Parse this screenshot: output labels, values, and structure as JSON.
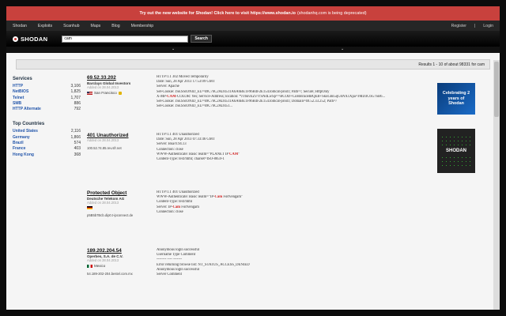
{
  "banner": {
    "message": "Try out the new website for Shodan! Click here to visit https://www.shodan.io",
    "sub": "(shodanhq.com is being deprecated)"
  },
  "nav": {
    "items": [
      "Shodan",
      "Exploits",
      "Scanhub",
      "Maps",
      "Blog",
      "Membership"
    ],
    "register": "Register",
    "separator": "|",
    "login": "Login"
  },
  "header": {
    "logo": "SHODAN",
    "search_value": "cam",
    "search_button": "Search"
  },
  "results": {
    "summary": "Results 1 - 10 of about 98331 for cam"
  },
  "sidebar": {
    "services_title": "Services",
    "services": [
      {
        "name": "HTTP",
        "count": "3,106"
      },
      {
        "name": "NetBIOS",
        "count": "1,825"
      },
      {
        "name": "Telnet",
        "count": "1,707"
      },
      {
        "name": "SMB",
        "count": "886"
      },
      {
        "name": "HTTP Alternate",
        "count": "792"
      }
    ],
    "countries_title": "Top Countries",
    "countries": [
      {
        "name": "United States",
        "count": "2,116"
      },
      {
        "name": "Germany",
        "count": "1,866"
      },
      {
        "name": "Brazil",
        "count": "574"
      },
      {
        "name": "France",
        "count": "403"
      },
      {
        "name": "Hong Kong",
        "count": "368"
      }
    ]
  },
  "hosts": [
    {
      "ip": "69.52.33.202",
      "org": "Barclays Global Investors",
      "meta": "Added on 28.04.2013",
      "location": "San Francisco",
      "flag": "us",
      "hostname": "",
      "banner": [
        "HTTP/1.1 302 Moved Temporarily",
        "Date: Sun, 28 Apr 2013 17:53:09 GMT",
        "Server: Apache",
        "Set-Cookie: JSESSIONID_EU=69C76C2AD4511A6A6BE1F96B4F2E154.tomcat-prod1; Path=/; Secure; HttpOnly",
        "X-MP-CAM-COLOR: Yes; Service-Address; location: *JTbuvEZv/YSNdLwSp==BCOD+CoHBcuoHBQEB+SkuGbn5qG6NX1Xpa=JMD3C6G7SB6...",
        "Set-Cookie: JSESSIONID_EU=69C76C2AD4511A6A6BE1F96B4F2E154.tomcat-prod1; Domain=69.52.33.252; Path=/",
        "Set-Cookie: JSESSIONID_EU=69C76C2AD451..."
      ]
    },
    {
      "ip": "401 Unauthorized",
      "org": "",
      "meta": "Added on 28.04.2013",
      "location": "",
      "flag": "generic",
      "hostname": "100.52.74.85.rev.sfr.net",
      "banner": [
        "HTTP/1.1 401 Unauthorized",
        "Date: Sun, 28 Apr 2013 07:33:46 GMT",
        "Server: Boa/0.94.13",
        "Connection: close",
        "WWW-Authenticate: Basic realm=\"PLANET IP CAM\"",
        "Content-Type: text/html; charset=ISO-8859-1"
      ]
    },
    {
      "ip": "Protected Object",
      "org": "Deutsche Telekom AG",
      "meta": "Added on 28.04.2013",
      "location": "",
      "flag": "de",
      "hostname": "p5B5b7Bcb.dip0.t-ipconnect.de",
      "banner": [
        "HTTP/1.1 401 Unauthorized",
        "WWW-Authenticate: Basic realm=\"IP-Cam Fortvengam\"",
        "Content-Type: text/html",
        "Server: IP-Cam Fortvengam",
        "Connection: close"
      ]
    },
    {
      "ip": "189.202.204.54",
      "org": "Operbes, S.A. de C.V.",
      "meta": "Added on 28.04.2013",
      "location": "Mexico",
      "flag": "mx",
      "hostname": "54.189-202-204.bestel.com.mx",
      "banner": [
        "",
        "Anonymous login successful",
        "",
        "Username Type Comment",
        "-------- ---- -------",
        "Error returning browse list: NT_STATUS_ACCESS_DENIED",
        "Anonymous login successful",
        "",
        "Server Comment"
      ]
    }
  ],
  "ads": {
    "ad1_lines": [
      "Celebrating 2",
      "years of",
      "Shodan"
    ],
    "ad2_label": "SHODAN"
  }
}
